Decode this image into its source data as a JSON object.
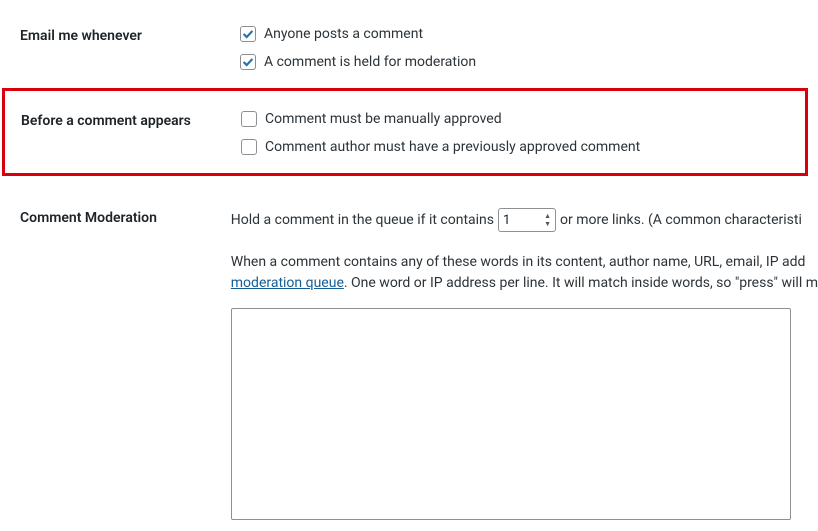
{
  "sections": {
    "emailMe": {
      "label": "Email me whenever",
      "options": [
        {
          "label": "Anyone posts a comment",
          "checked": true
        },
        {
          "label": "A comment is held for moderation",
          "checked": true
        }
      ]
    },
    "beforeComment": {
      "label": "Before a comment appears",
      "options": [
        {
          "label": "Comment must be manually approved",
          "checked": false
        },
        {
          "label": "Comment author must have a previously approved comment",
          "checked": false
        }
      ]
    },
    "moderation": {
      "label": "Comment Moderation",
      "holdTextBefore": "Hold a comment in the queue if it contains",
      "linkCount": "1",
      "holdTextAfter": "or more links. (A common characteristi",
      "paragraphPart1": "When a comment contains any of these words in its content, author name, URL, email, IP add",
      "queueLink": "moderation queue",
      "paragraphPart2": ". One word or IP address per line. It will match inside words, so \"press\" will m",
      "textarea": ""
    }
  }
}
